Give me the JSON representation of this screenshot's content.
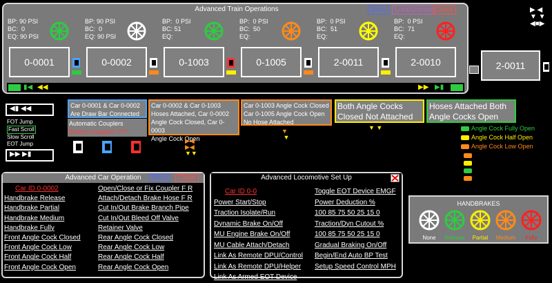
{
  "train_ops": {
    "title": "Advanced Train Operations",
    "more": "More",
    "locks": "Lock/Unlock",
    "close": "Close",
    "cars": [
      {
        "bp": "BP: 90 PSI",
        "bc": "BC:  0",
        "eq": "EQ: 90 PSI",
        "id": "0-0001",
        "wheel": "#2ecc40"
      },
      {
        "bp": "BP: 90 PSI",
        "bc": "BC:  0",
        "eq": "EQ: 90 PSI",
        "id": "0-0002",
        "wheel": "#ffffff"
      },
      {
        "bp": "BP:  0 PSI",
        "bc": "BC: 51",
        "eq": "EQ:",
        "id": "0-1003",
        "wheel": "#2ecc40"
      },
      {
        "bp": "BP:  0 PSI",
        "bc": "BC:  50",
        "eq": "EQ:",
        "id": "0-1005",
        "wheel": "#ff8a1a"
      },
      {
        "bp": "BP:  0 PSI",
        "bc": "BC:  51",
        "eq": "EQ:",
        "id": "2-0011",
        "wheel": "#ffff00"
      },
      {
        "bp": "BP:  0 PSI",
        "bc": "BC:  71",
        "eq": "EQ:",
        "id": "2-0010",
        "wheel": "#ff2020"
      }
    ],
    "detached_car": "2-0011"
  },
  "status": {
    "box1_line1": "Car 0-0001 & Car 0-0002",
    "box1_line2": "Are Draw Bar Connected",
    "box1b_line1": "Automatic Couplers",
    "box1b_line2": "Broken Couplers ???",
    "box2": [
      "Car 0-0002 & Car 0-1003",
      "Hoses Attached, Car 0-0002",
      "Angle Cock Closed, Car 0-0003",
      "Angle Cock Open"
    ],
    "box3": [
      "Car 0-1003 Angle Cock Closed",
      "Car 0-1005 Angle Cock Open",
      "No Hose Attached"
    ],
    "box4": [
      "Both Angle Cocks",
      "Closed Not Attached"
    ],
    "box5": [
      "Hoses Attached Both",
      "Angle Cocks Open"
    ]
  },
  "scroll": {
    "fot_jump": "FOT Jump",
    "fast": "Fast Scroll",
    "slow": "Slow Scroll",
    "eot_jump": "EOT Jump"
  },
  "legend": [
    {
      "label": "Angle Cock Fully Open",
      "color": "#2ecc40"
    },
    {
      "label": "Angle Cock Half Open",
      "color": "#ffee00"
    },
    {
      "label": "Angle Cock Low Open",
      "color": "#ff8a1a"
    }
  ],
  "car_ops": {
    "title": "Advanced Car Operation",
    "more": "More",
    "close": "Close",
    "left": [
      "Car ID 0-0002",
      "Handbrake Release",
      "Handbrake Partial",
      "Handbrake Medium",
      "Handbrake Fully",
      "Front Angle Cock Closed",
      "Front Angle Cock Low",
      "Front Angle Cock Half",
      "Front Angle Cock Open"
    ],
    "right": [
      "Open/Close or Fix Coupler  F  R",
      "Attach/Detach Brake Hose  F  R",
      "Cut In/Out Brake Branch Pipe",
      "Cut In/Out Bleed Off Valve",
      "Retainer Valve",
      "Rear Angle Cock Closed",
      "Rear Angle Cock Low",
      "Rear Angle Cock Half",
      "Rear Angle Cock Open"
    ]
  },
  "loco_ops": {
    "title": "Advanced Locomotive Set Up",
    "left": [
      "Car ID  0-0",
      "Power Start/Stop",
      "Traction  Isolate/Run",
      "Dynamic Brake On/Off",
      "MU Engine Brake On/Off",
      "MU Cable Attach/Detach",
      "Link As Remote DPU/Control",
      "Link As Remote DPU/Helper",
      "Link As Armed EOT Device"
    ],
    "right": [
      "Toggle EOT Device EMGF",
      "Power Deduction %",
      "100  85  75  50  25  15  0",
      "Traction/Dyn Cutout %",
      "100  85  75  50  25  15  0",
      "Gradual Braking On/Off",
      "Begin/End Auto BP Test",
      "Setup Speed Control MPH"
    ]
  },
  "handbrakes": {
    "title": "HANDBRAKES",
    "items": [
      {
        "label": "None",
        "color": "#ffffff"
      },
      {
        "label": "Release",
        "color": "#2ecc40"
      },
      {
        "label": "Partial",
        "color": "#ffee00"
      },
      {
        "label": "Medium",
        "color": "#ff8a1a"
      },
      {
        "label": "Fully",
        "color": "#ff2020"
      }
    ]
  }
}
